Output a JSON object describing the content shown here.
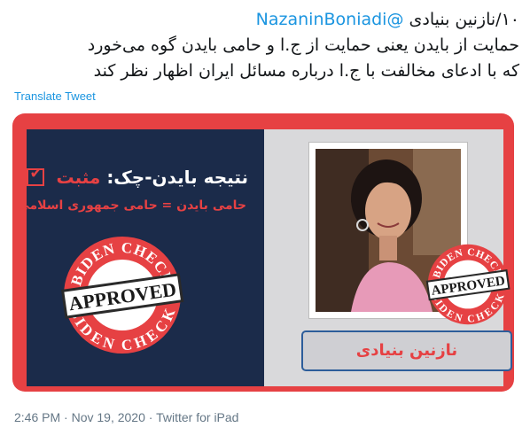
{
  "tweet": {
    "line1_prefix": "۱۰/نازنین بنیادی",
    "mention": "@NazaninBoniadi",
    "line2": "حمایت از بایدن یعنی حمایت از ج.ا و حامی بایدن گوه می‌خورد",
    "line3": "که با ادعای مخالفت با ج.ا درباره مسائل ایران اظهار نظر کند",
    "translate_label": "Translate Tweet"
  },
  "card": {
    "result_label": "نتیجه بایدن-چک:",
    "result_value": "مثبت",
    "subtitle": "حامی بایدن = حامی جمهوری اسلامی",
    "stamp_top": "BIDEN CHECK",
    "stamp_bottom": "BIDEN CHECK",
    "stamp_word": "APPROVED",
    "name": "نازنین بنیادی",
    "colors": {
      "card_red": "#e64143",
      "left_navy": "#1b2b4a",
      "right_gray": "#d9d9db",
      "name_border": "#2d5d9a"
    }
  },
  "meta": {
    "time": "2:46 PM",
    "date": "Nov 19, 2020",
    "source": "Twitter for iPad"
  }
}
